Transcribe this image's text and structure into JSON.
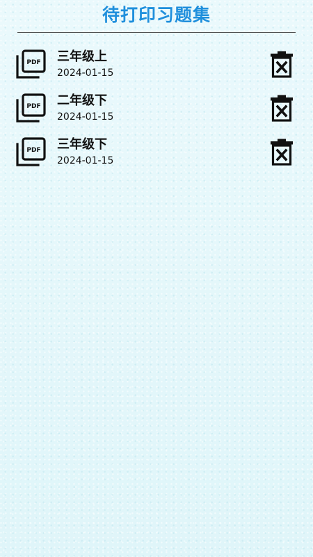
{
  "header": {
    "title": "待打印习题集"
  },
  "files": [
    {
      "name": "三年级上",
      "date": "2024-01-15",
      "icon": "pdf-icon",
      "action_icon": "trash-icon"
    },
    {
      "name": "二年级下",
      "date": "2024-01-15",
      "icon": "pdf-icon",
      "action_icon": "trash-icon"
    },
    {
      "name": "三年级下",
      "date": "2024-01-15",
      "icon": "pdf-icon",
      "action_icon": "trash-icon"
    }
  ],
  "pdf_icon_label": "PDF",
  "colors": {
    "title": "#1f8fdc",
    "background": "#e4f8fb",
    "text": "#111111"
  }
}
